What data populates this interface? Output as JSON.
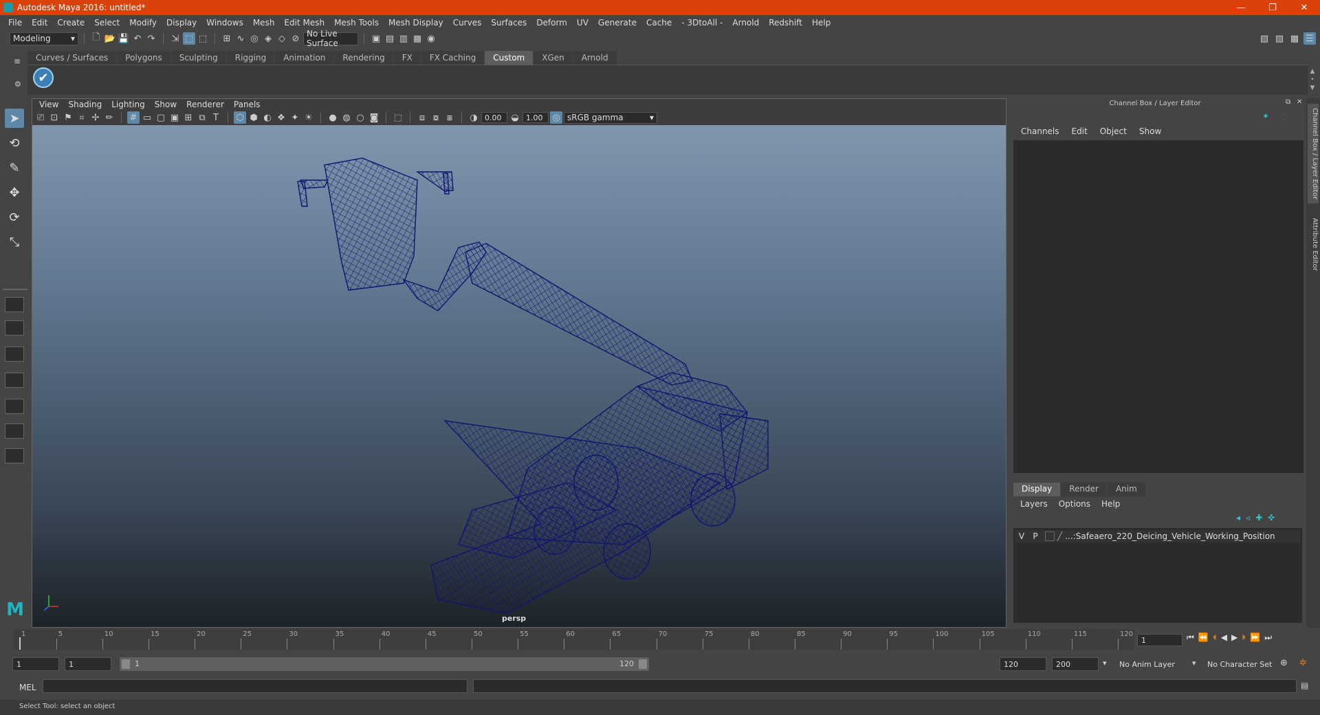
{
  "window": {
    "title": "Autodesk Maya 2016: untitled*",
    "minimize": "—",
    "restore": "❐",
    "close": "✕"
  },
  "menu": [
    "File",
    "Edit",
    "Create",
    "Select",
    "Modify",
    "Display",
    "Windows",
    "Mesh",
    "Edit Mesh",
    "Mesh Tools",
    "Mesh Display",
    "Curves",
    "Surfaces",
    "Deform",
    "UV",
    "Generate",
    "Cache",
    "- 3DtoAll -",
    "Arnold",
    "Redshift",
    "Help"
  ],
  "statusline": {
    "mode": "Modeling",
    "live_surface": "No Live Surface"
  },
  "shelf": {
    "tabs": [
      "Curves / Surfaces",
      "Polygons",
      "Sculpting",
      "Rigging",
      "Animation",
      "Rendering",
      "FX",
      "FX Caching",
      "Custom",
      "XGen",
      "Arnold"
    ],
    "active_tab": "Custom"
  },
  "viewport": {
    "menu": [
      "View",
      "Shading",
      "Lighting",
      "Show",
      "Renderer",
      "Panels"
    ],
    "exposure": "0.00",
    "gamma": "1.00",
    "color_space": "sRGB gamma",
    "camera_label": "persp",
    "wire_color": "#0f1470"
  },
  "channel_box": {
    "title": "Channel Box / Layer Editor",
    "menu": [
      "Channels",
      "Edit",
      "Object",
      "Show"
    ],
    "layer_tabs": [
      "Display",
      "Render",
      "Anim"
    ],
    "active_layer_tab": "Display",
    "layer_menu": [
      "Layers",
      "Options",
      "Help"
    ],
    "layer": {
      "v": "V",
      "p": "P",
      "name": "...:Safeaero_220_Deicing_Vehicle_Working_Position"
    },
    "side_tabs": [
      "Channel Box / Layer Editor",
      "Attribute Editor"
    ]
  },
  "timeline": {
    "tick_labels": [
      "1",
      "5",
      "10",
      "15",
      "20",
      "25",
      "30",
      "35",
      "40",
      "45",
      "50",
      "55",
      "60",
      "65",
      "70",
      "75",
      "80",
      "85",
      "90",
      "95",
      "100",
      "105",
      "110",
      "115",
      "120"
    ],
    "current_frame": "1"
  },
  "range": {
    "start": "1",
    "playback_start": "1",
    "slider_start": "1",
    "slider_end": "120",
    "playback_end": "120",
    "end": "200",
    "anim_layer": "No Anim Layer",
    "character_set": "No Character Set"
  },
  "command_line": {
    "language": "MEL"
  },
  "help_line": "Select Tool: select an object"
}
